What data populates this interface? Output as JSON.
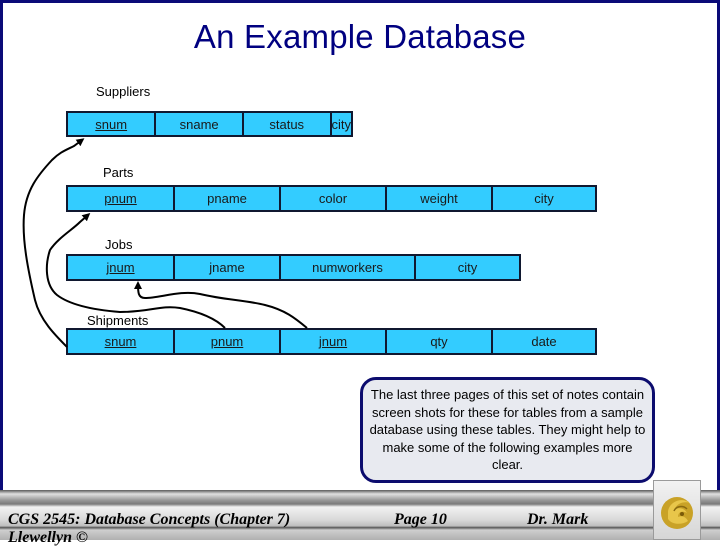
{
  "slide": {
    "title": "An Example Database"
  },
  "tables": {
    "suppliers": {
      "label": "Suppliers",
      "columns": [
        {
          "name": "snum",
          "key": true
        },
        {
          "name": "sname",
          "key": false
        },
        {
          "name": "status",
          "key": false
        },
        {
          "name": "city",
          "key": false
        }
      ]
    },
    "parts": {
      "label": "Parts",
      "columns": [
        {
          "name": "pnum",
          "key": true
        },
        {
          "name": "pname",
          "key": false
        },
        {
          "name": "color",
          "key": false
        },
        {
          "name": "weight",
          "key": false
        },
        {
          "name": "city",
          "key": false
        }
      ]
    },
    "jobs": {
      "label": "Jobs",
      "columns": [
        {
          "name": "jnum",
          "key": true
        },
        {
          "name": "jname",
          "key": false
        },
        {
          "name": "numworkers",
          "key": false
        },
        {
          "name": "city",
          "key": false
        }
      ]
    },
    "shipments": {
      "label": "Shipments",
      "columns": [
        {
          "name": "snum",
          "key": true
        },
        {
          "name": "pnum",
          "key": true
        },
        {
          "name": "jnum",
          "key": true
        },
        {
          "name": "qty",
          "key": false
        },
        {
          "name": "date",
          "key": false
        }
      ]
    }
  },
  "relationships": [
    {
      "from": "shipments.snum",
      "to": "suppliers.snum"
    },
    {
      "from": "shipments.pnum",
      "to": "parts.pnum"
    },
    {
      "from": "shipments.jnum",
      "to": "jobs.jnum"
    }
  ],
  "note": {
    "text": "The last three pages of this set of notes contain screen shots for these for tables from a sample database using these tables. They might help to make some of the following examples more clear."
  },
  "footer": {
    "course": "CGS 2545: Database Concepts  (Chapter 7)",
    "page": "Page 10",
    "author": "Dr. Mark",
    "author_cont": "Llewellyn ©"
  },
  "colors": {
    "title": "#000080",
    "table_fill": "#33ccff",
    "frame": "#0a0a78",
    "note_fill": "#e8eaf0"
  }
}
